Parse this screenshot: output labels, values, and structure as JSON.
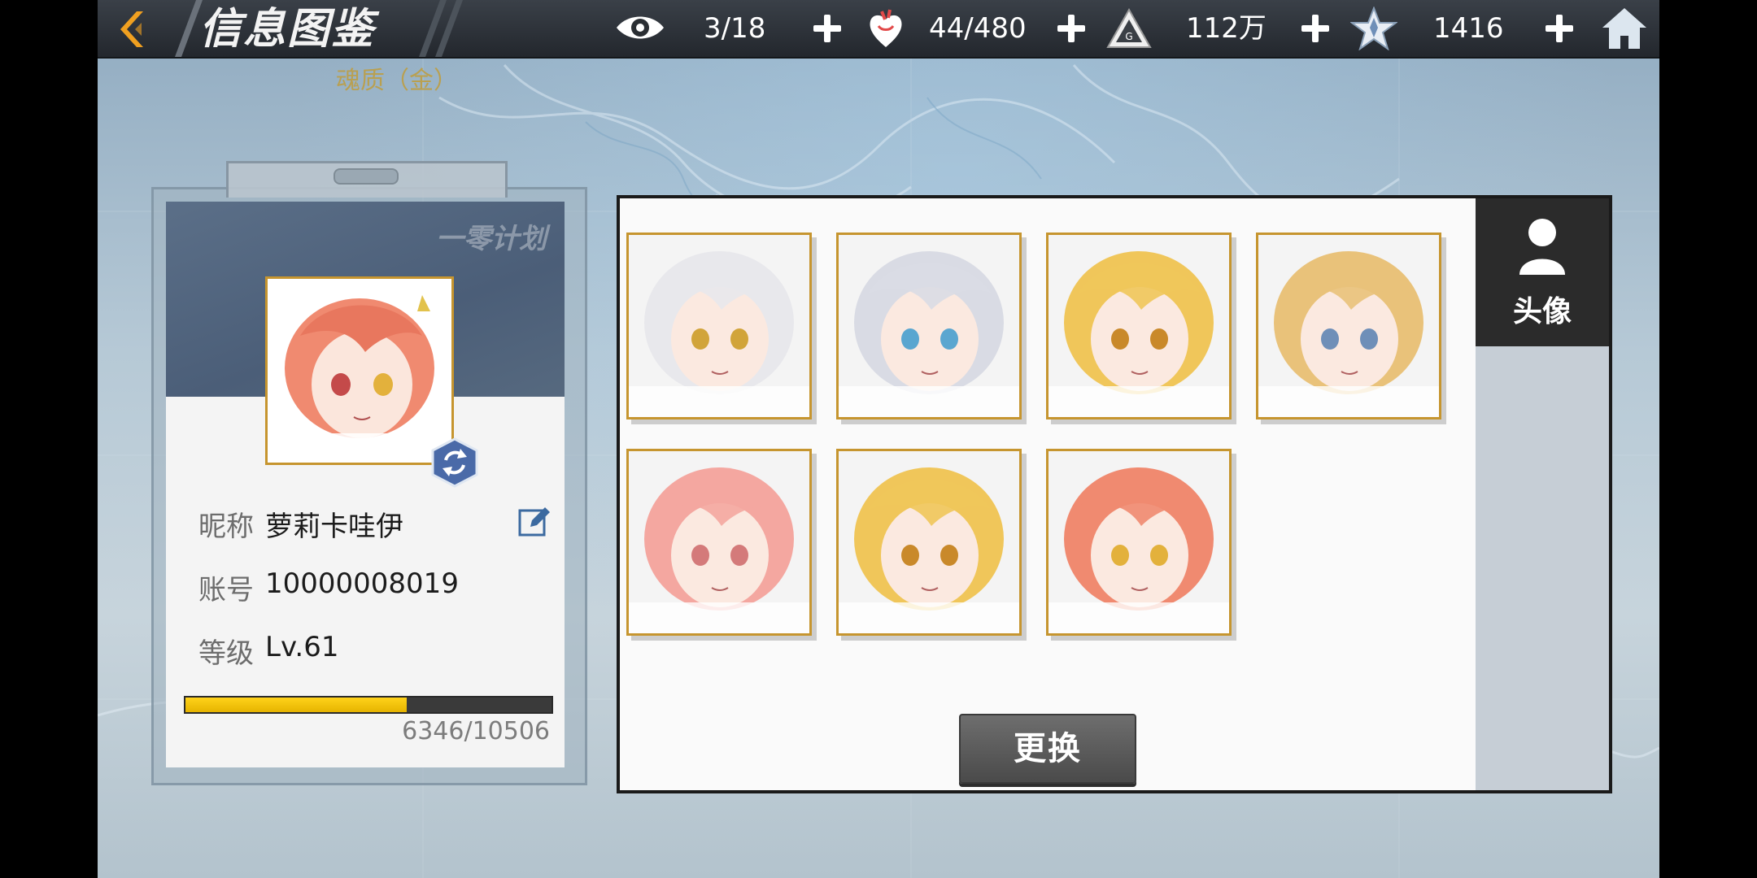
{
  "header": {
    "title": "信息图鉴",
    "subtitle": "魂质（金）"
  },
  "resources": [
    {
      "name": "vision",
      "icon": "eye-icon",
      "value": "3/18"
    },
    {
      "name": "stamina",
      "icon": "heart-icon",
      "value": "44/480"
    },
    {
      "name": "currency",
      "icon": "triangle-emblem-icon",
      "value": "112万"
    },
    {
      "name": "crystal",
      "icon": "star-crystal-icon",
      "value": "1416"
    }
  ],
  "profile": {
    "logo_text": "一零计划",
    "nickname_label": "昵称",
    "nickname": "萝莉卡哇伊",
    "account_label": "账号",
    "account": "10000008019",
    "level_label": "等级",
    "level": "Lv.61",
    "xp_current": 6346,
    "xp_max": 10506,
    "xp_text": "6346/10506"
  },
  "avatar_grid": {
    "change_label": "更换",
    "portraits": [
      {
        "name": "avatar-white-hair-horns",
        "hair": "#e8e8ec",
        "eye": "#d1a43a"
      },
      {
        "name": "avatar-silver-hair-ribbons",
        "hair": "#d9dbe4",
        "eye": "#5aa6d0"
      },
      {
        "name": "avatar-red-hood-blonde",
        "hair": "#f0c65a",
        "eye": "#c9892a"
      },
      {
        "name": "avatar-blonde-long-hair",
        "hair": "#e9c27a",
        "eye": "#6f8fb8"
      },
      {
        "name": "avatar-pink-hair-blade",
        "hair": "#f4a7a0",
        "eye": "#d47a7a"
      },
      {
        "name": "avatar-red-hood-blonde-2",
        "hair": "#f0c65a",
        "eye": "#c9892a"
      },
      {
        "name": "avatar-salmon-hair-selected",
        "hair": "#f08a70",
        "eye": "#e3b13c"
      }
    ]
  },
  "side_tabs": {
    "avatar_tab_label": "头像"
  },
  "colors": {
    "accent_gold": "#c6952f",
    "xp_fill": "#ffd21a",
    "back_arrow": "#f0a020"
  }
}
